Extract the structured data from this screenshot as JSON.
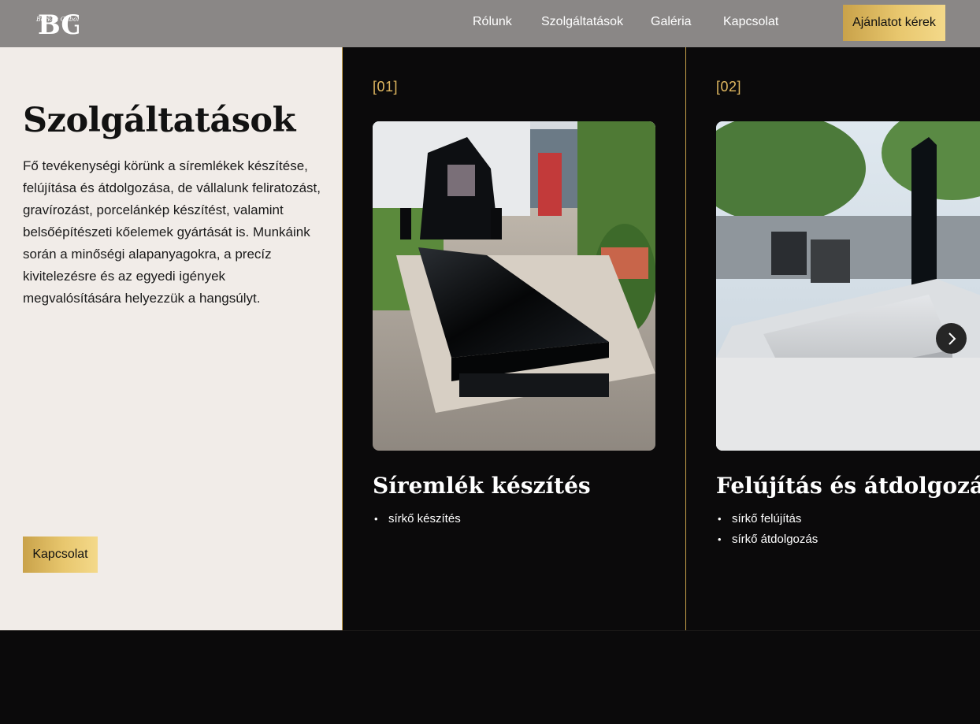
{
  "header": {
    "logo": {
      "letters": "BG",
      "script": "Berkes Gábor",
      "icon": "brand-monogram-logo"
    },
    "nav": [
      "Rólunk",
      "Szolgáltatások",
      "Galéria",
      "Kapcsolat"
    ],
    "cta_label": "Ajánlatot kérek",
    "background": "#8a8786"
  },
  "intro": {
    "title": "Szolgáltatások",
    "text": "Fő tevékenységi körünk a síremlékek készítése, felújítása és átdolgozása, de vállalunk feliratozást, gravírozást, porcelánkép készítést, valamint belsőépítészeti kőelemek gyártását is. Munkáink során a minőségi alapanyagokra, a precíz kivitelezésre és az egyedi igények megvalósítására helyezzük a hangsúlyt.",
    "button_label": "Kapcsolat",
    "background": "#f1ece8"
  },
  "cards": [
    {
      "number": "[01]",
      "title": "Síremlék készítés",
      "items": [
        "sírkő készítés"
      ]
    },
    {
      "number": "[02]",
      "title": "Felújítás és átdolgozás",
      "items": [
        "sírkő felújítás",
        "sírkő átdolgozás"
      ]
    }
  ],
  "carousel": {
    "next_icon": "chevron-right-icon"
  },
  "colors": {
    "accent_gold": "#e0b760",
    "gold_gradient_start": "#c9a24a",
    "gold_gradient_end": "#f4d98a",
    "dark_bg": "#0b0a0b"
  }
}
